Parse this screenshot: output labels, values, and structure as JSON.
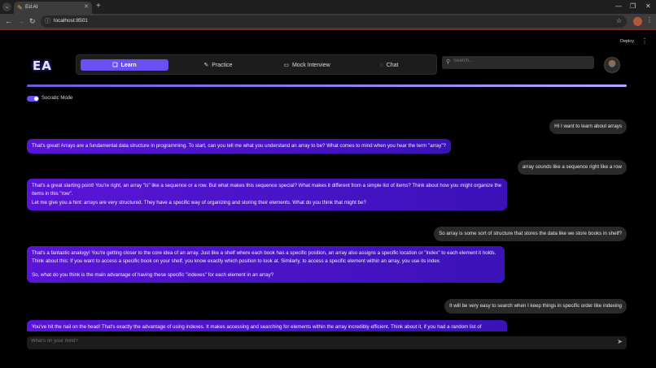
{
  "browser": {
    "tab_title": "Ed AI",
    "url": "localhost:8501"
  },
  "app": {
    "deploy_label": "Deploy",
    "logo_text": "EA",
    "nav": [
      {
        "label": "Learn",
        "icon": "book-icon"
      },
      {
        "label": "Practice",
        "icon": "pencil-icon"
      },
      {
        "label": "Mock Interview",
        "icon": "briefcase-icon"
      },
      {
        "label": "Chat",
        "icon": "chat-bubble-icon"
      }
    ],
    "search_placeholder": "Search...",
    "socratic_mode_label": "Socratic Mode",
    "socratic_mode_on": true,
    "composer_placeholder": "What's on your mind?",
    "accent_color": "#6b4ff2"
  },
  "messages": [
    {
      "role": "user",
      "text": "HI I want to learn about arrays"
    },
    {
      "role": "bot",
      "paragraphs": [
        "That's great! Arrays are a fundamental data structure in programming. To start, can you tell me what you understand an array to be? What comes to mind when you hear the term \"array\"?"
      ]
    },
    {
      "role": "user",
      "text": "array sounds like a sequence right like a row"
    },
    {
      "role": "bot",
      "paragraphs": [
        "That's a great starting point! You're right, an array \"is\" like a sequence or a row. But what makes this sequence special? What makes it different from a simple list of items? Think about how you might organize the items in this \"row\".",
        "Let me give you a hint: arrays are very structured. They have a specific way of organizing and storing their elements. What do you think that might be?"
      ]
    },
    {
      "role": "user",
      "text": "So array is some sort of structure that stores the data like we store books in shelf?"
    },
    {
      "role": "bot",
      "paragraphs": [
        "That's a fantastic analogy! You're getting closer to the core idea of an array. Just like a shelf where each book has a specific position, an array also assigns a specific location or \"index\" to each element it holds. Think about this: If you want to access a specific book on your shelf, you know exactly which position to look at. Similarly, to access a specific element within an array, you use its index.",
        "",
        "So, what do you think is the main advantage of having these specific \"indexes\" for each element in an array?"
      ]
    },
    {
      "role": "user",
      "text": "It will be very easy to search when I keep things in specific order like indexing"
    },
    {
      "role": "bot",
      "paragraphs": [
        "You've hit the nail on the head! That's exactly the advantage of using indexes. It makes accessing and searching for elements within the array incredibly efficient. Think about it, if you had a random list of"
      ]
    }
  ]
}
